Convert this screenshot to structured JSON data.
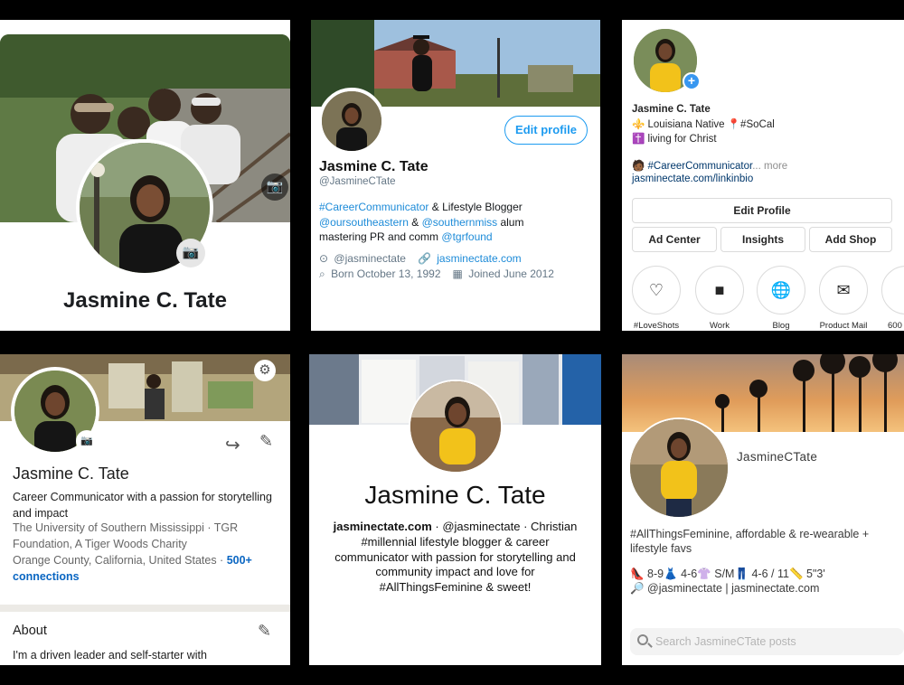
{
  "facebook": {
    "name": "Jasmine C. Tate"
  },
  "twitter": {
    "edit_label": "Edit profile",
    "name": "Jasmine C. Tate",
    "handle": "@JasmineCTate",
    "bio_line1_link1": "#CareerCommunicator",
    "bio_line1_text": " & Lifestyle Blogger",
    "bio_line2_link1": "@oursoutheastern",
    "bio_line2_amp": " & ",
    "bio_line2_link2": "@southernmiss",
    "bio_line2_text": " alum",
    "bio_line3_text": "mastering PR and comm ",
    "bio_line3_link": "@tgrfound",
    "location": "@jasminectate",
    "website": "jasminectate.com",
    "born": "Born October 13, 1992",
    "joined": "Joined June 2012"
  },
  "instagram": {
    "name": "Jasmine C. Tate",
    "line1": "⚜️ Louisiana Native 📍#SoCal",
    "line2": "✝️ living for Christ",
    "line3_link": "#CareerCommunicator",
    "line3_rest": "... more",
    "link": "jasminectate.com/linkinbio",
    "edit_profile": "Edit Profile",
    "ad_center": "Ad Center",
    "insights": "Insights",
    "add_shop": "Add Shop",
    "highlights": [
      {
        "label": "#LoveShots",
        "icon": "heart-icon"
      },
      {
        "label": "Work",
        "icon": "briefcase-icon"
      },
      {
        "label": "Blog",
        "icon": "globe-icon"
      },
      {
        "label": "Product Mail",
        "icon": "mail-icon"
      },
      {
        "label": "600"
      }
    ]
  },
  "linkedin": {
    "name": "Jasmine C. Tate",
    "tagline": "Career Communicator with a passion for storytelling and impact",
    "edu": "The University of Southern Mississippi · TGR Foundation, A Tiger Woods Charity",
    "location": "Orange County, California, United States · ",
    "connections": "500+ connections",
    "about_title": "About",
    "about_text": "I'm a driven leader and self-starter with"
  },
  "pinterest": {
    "name": "Jasmine C. Tate",
    "site": "jasminectate.com",
    "bio_rest": " · @jasminectate · Christian #millennial lifestyle blogger & career communicator with passion for storytelling and community impact and love for #AllThingsFeminine & sweet!"
  },
  "liketoknowit": {
    "username": "JasmineCTate",
    "bio": "#AllThingsFeminine, affordable & re-wearable + lifestyle favs",
    "sizes": "👠 8-9👗 4-6👚 S/M👖 4-6 / 11📏 5\"3'",
    "contact": "🔎 @jasminectate | jasminectate.com",
    "search_placeholder": "Search JasmineCTate posts"
  }
}
